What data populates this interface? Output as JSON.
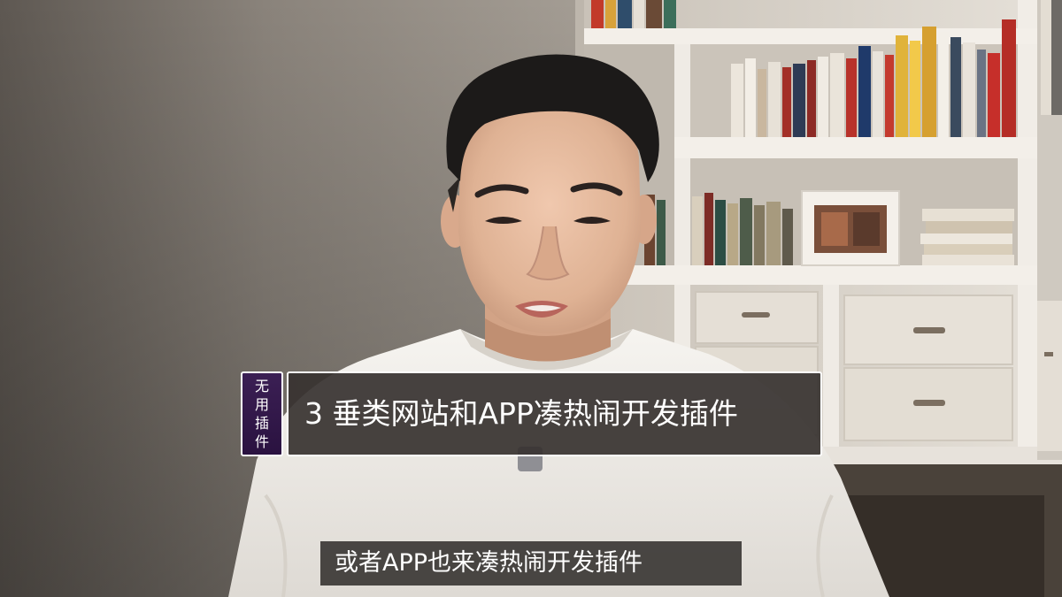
{
  "overlay": {
    "tag_chars": [
      "无",
      "用",
      "插",
      "件"
    ],
    "title": "3 垂类网站和APP凑热闹开发插件",
    "subtitle": "或者APP也来凑热闹开发插件",
    "tag_color": "#3b1f54",
    "border_color": "#ffffff"
  },
  "scene": {
    "description_label": "Young man with short dark hair in a white T-shirt speaking to camera in front of white bookshelves",
    "wall_color": "#9a9288",
    "shelf_color": "#d8d3cc",
    "shirt_color": "#f2f0ec",
    "hair_color": "#1c1a19",
    "skin_color": "#e2b79c"
  }
}
